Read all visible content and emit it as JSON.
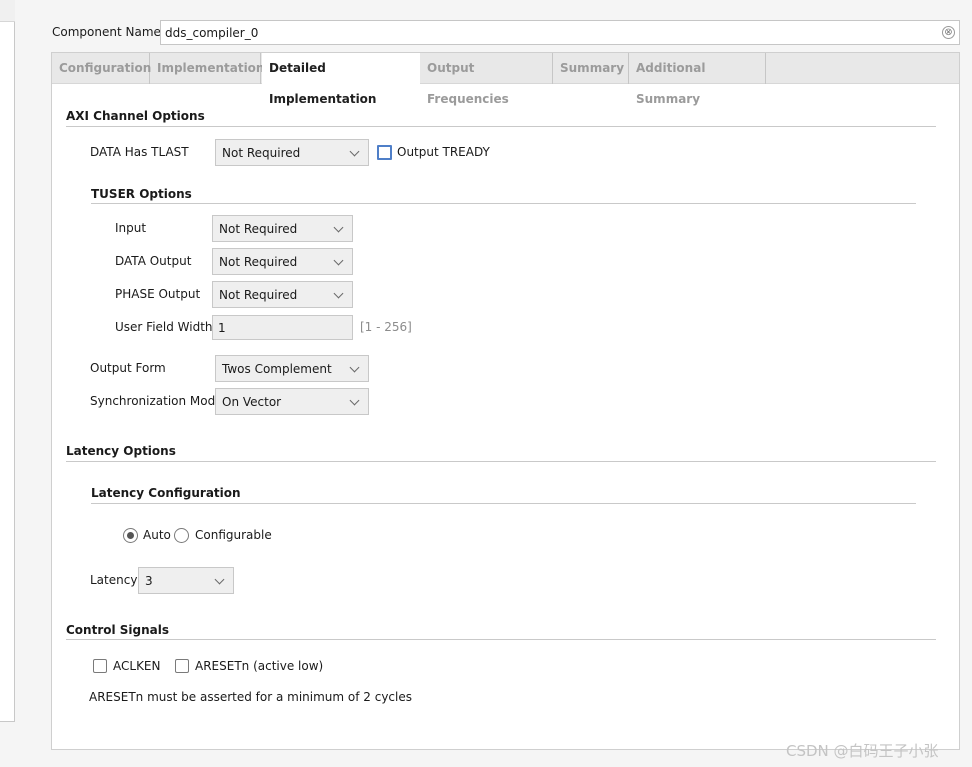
{
  "header": {
    "component_name_label": "Component Name",
    "component_name_value": "dds_compiler_0",
    "clear_glyph": "⊗"
  },
  "tabs": [
    {
      "label": "Configuration",
      "active": false
    },
    {
      "label": "Implementation",
      "active": false
    },
    {
      "label": "Detailed Implementation",
      "active": true
    },
    {
      "label": "Output Frequencies",
      "active": false
    },
    {
      "label": "Summary",
      "active": false
    },
    {
      "label": "Additional Summary",
      "active": false
    }
  ],
  "axi": {
    "title": "AXI Channel Options",
    "data_has_tlast_label": "DATA Has TLAST",
    "data_has_tlast_value": "Not Required",
    "output_tready_label": "Output TREADY",
    "output_tready_checked": false,
    "tuser": {
      "title": "TUSER Options",
      "input_label": "Input",
      "input_value": "Not Required",
      "data_output_label": "DATA Output",
      "data_output_value": "Not Required",
      "phase_output_label": "PHASE Output",
      "phase_output_value": "Not Required",
      "user_field_width_label": "User Field Width",
      "user_field_width_value": "1",
      "user_field_width_range": "[1 - 256]"
    },
    "output_form_label": "Output Form",
    "output_form_value": "Twos Complement",
    "sync_mode_label": "Synchronization Mode",
    "sync_mode_value": "On Vector"
  },
  "latency": {
    "title": "Latency Options",
    "config_title": "Latency Configuration",
    "auto_label": "Auto",
    "configurable_label": "Configurable",
    "selected": "Auto",
    "latency_label": "Latency",
    "latency_value": "3"
  },
  "control": {
    "title": "Control Signals",
    "aclken_label": "ACLKEN",
    "aclken_checked": false,
    "aresetn_label": "ARESETn (active low)",
    "aresetn_checked": false,
    "note": "ARESETn must be asserted for a minimum of 2 cycles"
  },
  "watermark": "CSDN @白码王子小张",
  "colors": {
    "accent_checkbox": "#4f7fc8",
    "panel_bg": "#ffffff",
    "tab_inactive_text": "#9b9b9b"
  }
}
